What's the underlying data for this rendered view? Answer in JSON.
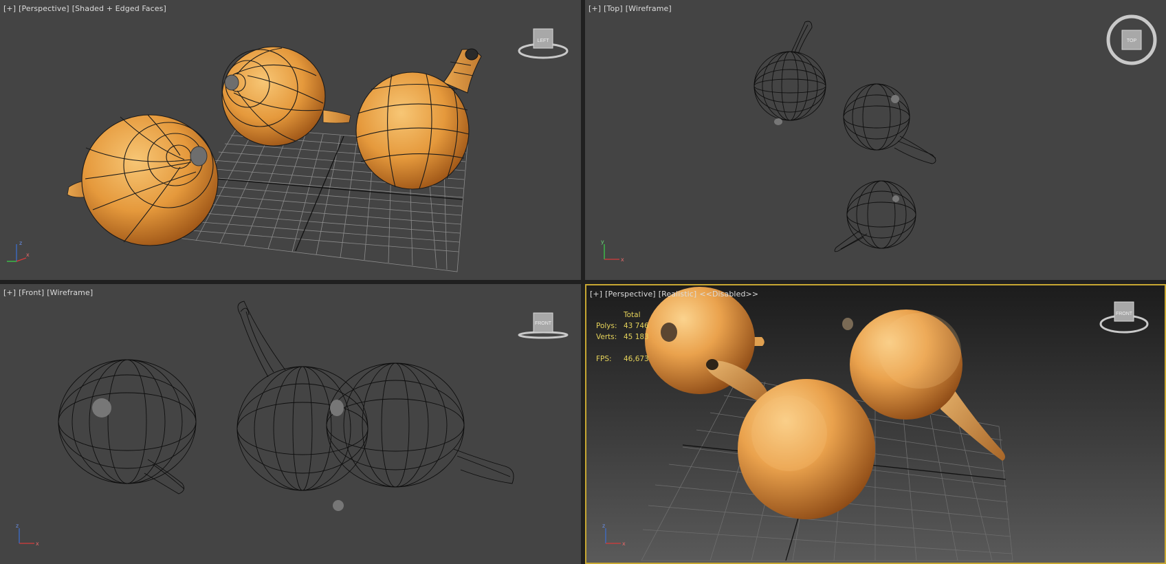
{
  "viewports": {
    "top_left": {
      "label": {
        "menu": "[+]",
        "view": "[Perspective]",
        "shading": "[Shaded + Edged Faces]"
      },
      "viewcube": "LEFT"
    },
    "top_right": {
      "label": {
        "menu": "[+]",
        "view": "[Top]",
        "shading": "[Wireframe]"
      },
      "viewcube": "TOP"
    },
    "bottom_left": {
      "label": {
        "menu": "[+]",
        "view": "[Front]",
        "shading": "[Wireframe]"
      },
      "viewcube": "FRONT"
    },
    "bottom_right": {
      "label": {
        "menu": "[+]",
        "view": "[Perspective]",
        "shading": "[Realistic]",
        "extra": "<<Disabled>>"
      },
      "viewcube": "FRONT",
      "stats": {
        "header": "Total",
        "polys_label": "Polys:",
        "polys": "43 746",
        "verts_label": "Verts:",
        "verts": "45 183",
        "fps_label": "FPS:",
        "fps": "46,673"
      }
    }
  },
  "colors": {
    "viewport_bg": "#444444",
    "active_border": "#c8a832",
    "stats_text": "#e6d35a",
    "onion_light": "#f0b35a",
    "onion_dark": "#b8661f",
    "wire": "#111111",
    "grid": "#8a8a8a"
  }
}
